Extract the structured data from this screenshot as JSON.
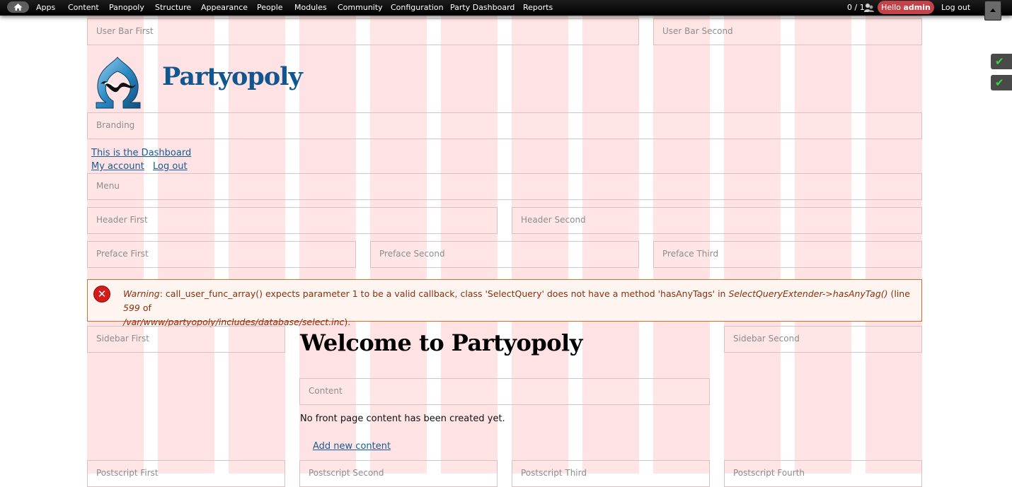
{
  "toolbar": {
    "home_icon": "home-icon",
    "menu": [
      "Apps",
      "Content",
      "Panopoly",
      "Structure",
      "Appearance",
      "People",
      "Modules",
      "Community",
      "Configuration",
      "Party Dashboard",
      "Reports"
    ],
    "user_count": "0 / 1",
    "users_icon": "users-icon",
    "hello_prefix": "Hello",
    "hello_user": "admin",
    "logout": "Log out",
    "hello_color": "#c2444a"
  },
  "regions": {
    "user_bar_first": "User Bar First",
    "user_bar_second": "User Bar Second",
    "branding": "Branding",
    "menu": "Menu",
    "header_first": "Header First",
    "header_second": "Header Second",
    "preface_first": "Preface First",
    "preface_second": "Preface Second",
    "preface_third": "Preface Third",
    "sidebar_first": "Sidebar First",
    "sidebar_second": "Sidebar Second",
    "content": "Content",
    "postscript_first": "Postscript First",
    "postscript_second": "Postscript Second",
    "postscript_third": "Postscript Third",
    "postscript_fourth": "Postscript Fourth"
  },
  "branding": {
    "site_name": "Partyopoly",
    "logo_icon": "omega-logo"
  },
  "menu_links": {
    "dashboard": "This is the Dashboard",
    "my_account": "My account",
    "log_out": "Log out"
  },
  "message": {
    "label": "Warning",
    "text": ": call_user_func_array() expects parameter 1 to be a valid callback, class 'SelectQuery' does not have a method 'hasAnyTags' in ",
    "function": "SelectQueryExtender->hasAnyTag()",
    "line_prefix": " (line ",
    "line": "599",
    "of": " of",
    "path": "/var/www/partyopoly/includes/database/select.inc",
    "end": ").",
    "icon": "error-icon"
  },
  "main": {
    "title": "Welcome to Partyopoly",
    "empty_text": "No front page content has been created yet.",
    "add_link": "Add new content"
  },
  "side_toggles": [
    "check-icon",
    "check-icon"
  ],
  "colors": {
    "grid_overlay": "#ffe2e3",
    "link": "#155c96",
    "site_name": "#11568f",
    "warning_border": "#d36b3b",
    "warning_text": "#8c2e0b"
  }
}
